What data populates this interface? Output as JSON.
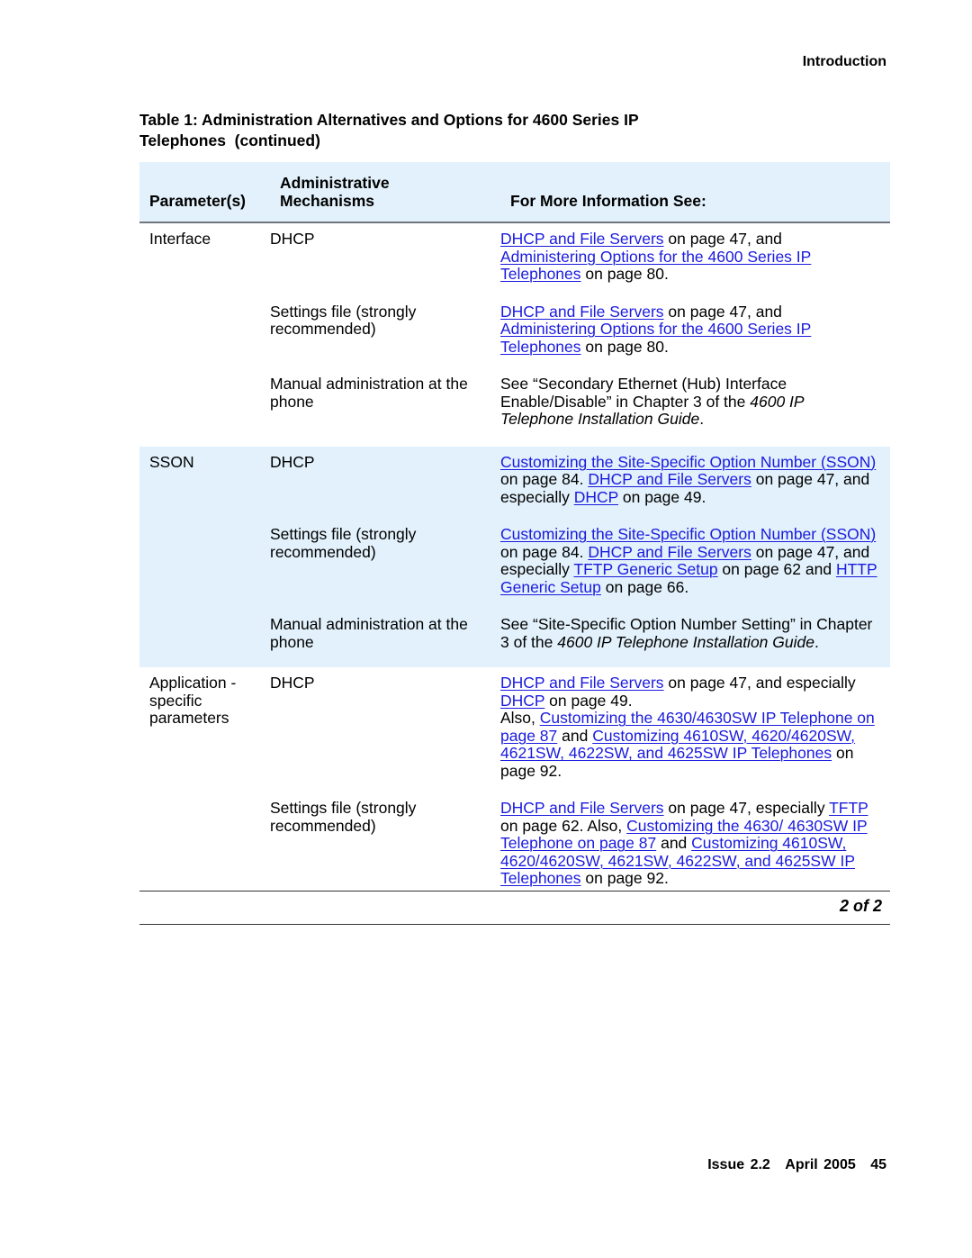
{
  "header": {
    "running_head": "Introduction"
  },
  "table": {
    "title_line1": "Table 1: Administration Alternatives and Options for 4600 Series IP",
    "title_line2": "Telephones  (continued)",
    "columns": {
      "parameters": "Parameter(s)",
      "mechanisms_line1": "Administrative",
      "mechanisms_line2": "Mechanisms",
      "info": "For More Information See:"
    },
    "groups": [
      {
        "parameter": "Interface",
        "rows": [
          {
            "mechanism": "DHCP",
            "info": [
              {
                "t": "DHCP and File Servers",
                "link": true
              },
              {
                "t": " on page 47, and "
              },
              {
                "t": "Administering Options for the 4600 Series IP Telephones",
                "link": true
              },
              {
                "t": " on page 80."
              }
            ]
          },
          {
            "mechanism": "Settings file (strongly recommended)",
            "info": [
              {
                "t": "DHCP and File Servers",
                "link": true
              },
              {
                "t": " on page 47, and "
              },
              {
                "t": "Administering Options for the 4600 Series IP Telephones",
                "link": true
              },
              {
                "t": " on page 80."
              }
            ]
          },
          {
            "mechanism": "Manual administration at the phone",
            "info": [
              {
                "t": "See “Secondary Ethernet (Hub) Interface Enable/Disable” in Chapter 3 of the "
              },
              {
                "t": "4600 IP Telephone Installation Guide",
                "italic": true
              },
              {
                "t": "."
              }
            ]
          }
        ]
      },
      {
        "parameter": "SSON",
        "rows": [
          {
            "mechanism": "DHCP",
            "info": [
              {
                "t": "Customizing the Site-Specific Option Number (SSON)",
                "link": true
              },
              {
                "t": " on page 84. "
              },
              {
                "t": "DHCP and File Servers",
                "link": true
              },
              {
                "t": " on page 47, and especially "
              },
              {
                "t": "DHCP",
                "link": true
              },
              {
                "t": " on page 49."
              }
            ]
          },
          {
            "mechanism": "Settings file (strongly recommended)",
            "info": [
              {
                "t": "Customizing the Site-Specific Option Number (SSON)",
                "link": true
              },
              {
                "t": " on page 84. "
              },
              {
                "t": "DHCP and File Servers",
                "link": true
              },
              {
                "t": " on page 47, and especially "
              },
              {
                "t": "TFTP Generic Setup",
                "link": true
              },
              {
                "t": " on page 62 and "
              },
              {
                "t": "HTTP Generic Setup",
                "link": true
              },
              {
                "t": " on page 66."
              }
            ]
          },
          {
            "mechanism": "Manual administration at the phone",
            "info": [
              {
                "t": "See “Site-Specific Option Number Setting” in Chapter 3 of the "
              },
              {
                "t": "4600 IP Telephone Installation Guide",
                "italic": true
              },
              {
                "t": "."
              }
            ]
          }
        ]
      },
      {
        "parameter": "Application - specific parameters",
        "rows": [
          {
            "mechanism": "DHCP",
            "info": [
              {
                "t": "DHCP and File Servers",
                "link": true
              },
              {
                "t": " on page 47, and especially "
              },
              {
                "t": "DHCP",
                "link": true
              },
              {
                "t": " on page 49.",
                "br_after": true
              },
              {
                "t": "Also, "
              },
              {
                "t": "Customizing the 4630/4630SW IP Telephone on page 87",
                "link": true
              },
              {
                "t": " and "
              },
              {
                "t": "Customizing 4610SW, 4620/4620SW, 4621SW, 4622SW, and 4625SW IP Telephones",
                "link": true
              },
              {
                "t": " on page 92."
              }
            ]
          },
          {
            "mechanism": "Settings file (strongly recommended)",
            "info": [
              {
                "t": "DHCP and File Servers",
                "link": true
              },
              {
                "t": " on page 47, especially "
              },
              {
                "t": "TFTP",
                "link": true
              },
              {
                "t": " on page 62. Also, "
              },
              {
                "t": "Customizing the 4630/ 4630SW IP Telephone on page 87",
                "link": true
              },
              {
                "t": " and "
              },
              {
                "t": "Customizing 4610SW, 4620/4620SW, 4621SW, 4622SW, and 4625SW IP Telephones",
                "link": true
              },
              {
                "t": " on page 92."
              }
            ]
          }
        ]
      }
    ],
    "page_count": "2 of 2"
  },
  "footer": {
    "issue": "Issue 2.2",
    "date": "April 2005",
    "page_number": "45"
  }
}
